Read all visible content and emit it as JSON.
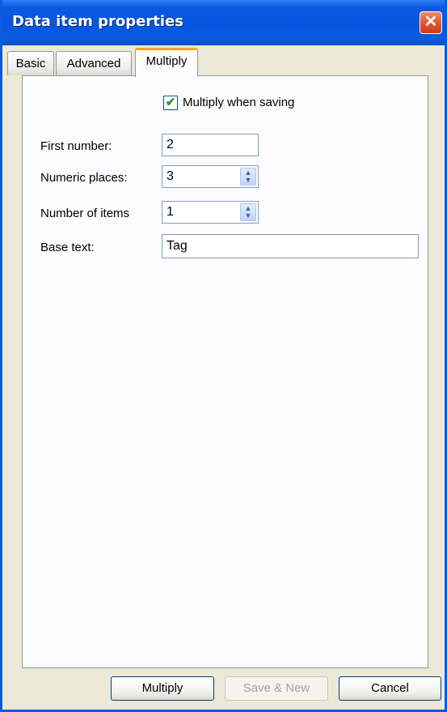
{
  "window": {
    "title": "Data item properties",
    "close_glyph": "✕"
  },
  "tabs": [
    {
      "label": "Basic",
      "active": false
    },
    {
      "label": "Advanced",
      "active": false
    },
    {
      "label": "Multiply",
      "active": true
    }
  ],
  "multiply_tab": {
    "checkbox": {
      "label": "Multiply when saving",
      "checked": true,
      "check_glyph": "✔"
    },
    "fields": {
      "first_number": {
        "label": "First number:",
        "value": "2"
      },
      "numeric_places": {
        "label": "Numeric places:",
        "value": "3"
      },
      "number_of_items": {
        "label": "Number of items",
        "value": "1"
      },
      "base_text": {
        "label": "Base text:",
        "value": "Tag"
      }
    },
    "spinner_glyphs": {
      "up": "▲",
      "down": "▼"
    }
  },
  "buttons": {
    "multiply": {
      "label": "Multiply",
      "enabled": true
    },
    "save_new": {
      "label": "Save & New",
      "enabled": false
    },
    "cancel": {
      "label": "Cancel",
      "enabled": true
    }
  },
  "colors": {
    "titlebar_blue": "#0656e2",
    "dialog_bg": "#ece9d8",
    "tab_highlight": "#f5a623",
    "close_red": "#e0502e"
  }
}
